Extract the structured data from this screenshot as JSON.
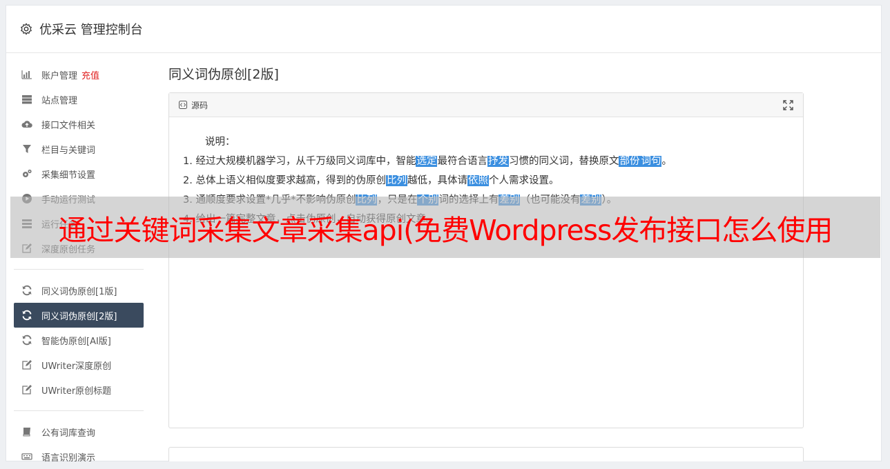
{
  "header": {
    "title": "优采云 管理控制台",
    "icon": "gear-icon"
  },
  "sidebar": {
    "group1": [
      {
        "label": "账户管理",
        "badge": "充值",
        "icon": "bar-chart-icon"
      },
      {
        "label": "站点管理",
        "icon": "server-icon"
      },
      {
        "label": "接口文件相关",
        "icon": "cloud-upload-icon"
      },
      {
        "label": "栏目与关键词",
        "icon": "filter-icon"
      },
      {
        "label": "采集细节设置",
        "icon": "gears-icon"
      },
      {
        "label": "手动运行测试",
        "icon": "play-icon"
      },
      {
        "label": "运行任务",
        "icon": "tasks-icon"
      },
      {
        "label": "深度原创任务",
        "icon": "edit-icon"
      }
    ],
    "group2": [
      {
        "label": "同义词伪原创[1版]",
        "icon": "refresh-icon"
      },
      {
        "label": "同义词伪原创[2版]",
        "icon": "refresh-icon",
        "active": true
      },
      {
        "label": "智能伪原创[AI版]",
        "icon": "refresh-icon"
      },
      {
        "label": "UWriter深度原创",
        "icon": "edit-icon"
      },
      {
        "label": "UWriter原创标题",
        "icon": "edit-icon"
      }
    ],
    "group3": [
      {
        "label": "公有词库查询",
        "icon": "book-icon"
      },
      {
        "label": "语言识别演示",
        "icon": "keyboard-icon"
      }
    ]
  },
  "main": {
    "title": "同义词伪原创[2版]",
    "editor": {
      "toolbar_label": "源码",
      "intro": "说明：",
      "lines": [
        [
          {
            "t": "1. 经过大规模机器学习，从千万级同义词库中，智能"
          },
          {
            "t": "选定",
            "h": true
          },
          {
            "t": "最符合语言"
          },
          {
            "t": "抒发",
            "h": true
          },
          {
            "t": "习惯的同义词，替换原文"
          },
          {
            "t": "部份",
            "h": true
          },
          {
            "t": "词句",
            "h": true
          },
          {
            "t": "。"
          }
        ],
        [
          {
            "t": "2. 总体上语义相似度要求越高，得到的伪原创"
          },
          {
            "t": "比列",
            "h": true
          },
          {
            "t": "越低，具体请"
          },
          {
            "t": "依照",
            "h": true
          },
          {
            "t": "个人需求设置。"
          }
        ],
        [
          {
            "t": "3. 通顺度要求设置*几乎*不影响伪原创"
          },
          {
            "t": "比列",
            "h": true
          },
          {
            "t": "，只是在"
          },
          {
            "t": "个别",
            "h": true
          },
          {
            "t": "词的选择上有"
          },
          {
            "t": "差别",
            "h": true
          },
          {
            "t": "（也可能没有"
          },
          {
            "t": "差别",
            "h": true
          },
          {
            "t": "）。"
          }
        ],
        [
          {
            "t": "4. 给出一篇完整文章，点击伪原创，自动获得原创文章。"
          }
        ]
      ]
    }
  },
  "overlay": {
    "text": "通过关键词采集文章采集api(免费Wordpress发布接口怎么使用"
  },
  "colors": {
    "active_bg": "#3a4a5e",
    "highlight": "#3b8fe0",
    "badge": "#e02020",
    "overlay_text": "#ff0000"
  }
}
